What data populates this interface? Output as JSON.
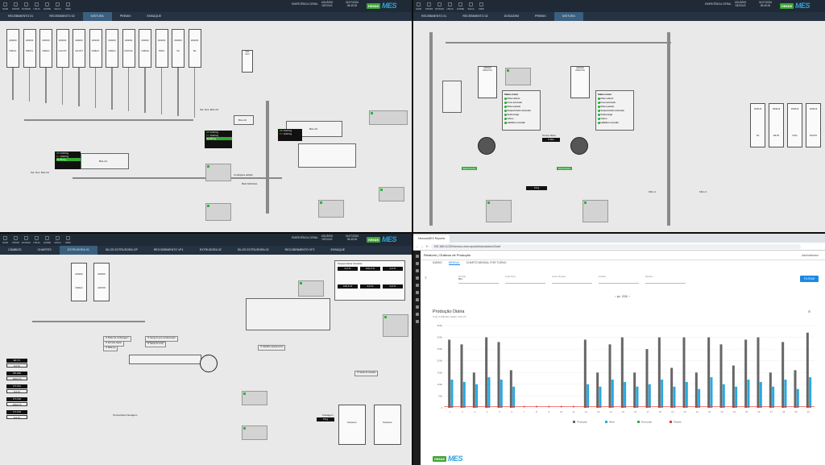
{
  "colors": {
    "scada_bg": "#e9e9e9",
    "topbar": "#1f2a36",
    "tabbar": "#243241",
    "active_tab": "#3a5f7f",
    "nexus_green": "#3fa535",
    "mes_blue": "#2ea3dc",
    "chart_blue": "#29a8e0",
    "chart_gray": "#666666",
    "chart_red": "#e53935"
  },
  "topbar": {
    "icons": [
      {
        "name": "exit-icon",
        "label": "SAIR"
      },
      {
        "name": "zoom-icon",
        "label": "ZOOM"
      },
      {
        "name": "bucket-icon",
        "label": "DOSAR"
      },
      {
        "name": "user-icon",
        "label": "USUA"
      },
      {
        "name": "home-icon",
        "label": "HOME"
      },
      {
        "name": "bag-icon",
        "label": "SACA"
      },
      {
        "name": "mes-icon",
        "label": "MES"
      }
    ],
    "emergency": "EMERGÊNCIA GERAL",
    "user_label": "USUÁRIO",
    "user": "NEXXUS",
    "date": "01/07/2026",
    "time": "08:45:26"
  },
  "brand": {
    "nexus": "nexus",
    "mes": "MES"
  },
  "q1": {
    "tabs": [
      "RECEBIMENTO 01",
      "RECEBIMENTO 02",
      "MISTURA",
      "PREMIX",
      "ENSAQUE"
    ],
    "active_tab": 2,
    "silos": [
      {
        "code": "2000030",
        "name": "FRETL1"
      },
      {
        "code": "2000030",
        "name": "FRETL2"
      },
      {
        "code": "2000030",
        "name": "FAREL2"
      },
      {
        "code": "2000030",
        "name": "CALCIT2"
      },
      {
        "code": "2000030",
        "name": "CALCIT3"
      },
      {
        "code": "2000030",
        "name": "FARELO"
      },
      {
        "code": "2000030",
        "name": "FAREL3"
      },
      {
        "code": "2000030",
        "name": "CASTCAL"
      },
      {
        "code": "2000030",
        "name": "CUBULE"
      },
      {
        "code": "2000030",
        "name": "TRIGO"
      },
      {
        "code": "2000030",
        "name": "SI1"
      },
      {
        "code": "2000030",
        "name": "SI2"
      }
    ],
    "silo_extra": {
      "code": "DS2",
      "name": "SIL3"
    },
    "bal01": "BAL-01",
    "bal02": "BAL-02",
    "bal03": "BAL-03",
    "sp_label": "SP",
    "pv_label": "PV",
    "sp": "0,00 Kg",
    "pv": "0,00 Kg",
    "tot": "47,80 Kg",
    "mix_value": "41,88 Kg",
    "sec_label": "Sel. Dos. BAL-01",
    "sec_label2": "Sel. Dos. BAL-03",
    "fail_note": "Condições adição",
    "bag_label": "BAG MANUAL"
  },
  "q2": {
    "tabs": [
      "RECEBIMENTO 01",
      "RECEBIMENTO 02",
      "DOSAGEM",
      "PREMIX",
      "MISTURA"
    ],
    "active_tab": 4,
    "tank1": {
      "code": "2000129",
      "name": "2000,8 KG"
    },
    "tank2": {
      "code": "2000129",
      "name": "2000,8 KG"
    },
    "legend": [
      "Motor aberto",
      "Freio acionado",
      "Motor parado",
      "Sequenciador acionado",
      "Sobrecarga",
      "Vácuo",
      "Habilitar rocessão"
    ],
    "legend_title": "Status motor",
    "press1": "Expressora",
    "press2": "Expressora",
    "rotary": "Rotativa",
    "temp_label": "Tempo Mixer",
    "temp": "0 Min",
    "filter": "Filtro 1",
    "filter2": "Filtro 2",
    "bottom_kg": "0 Kg",
    "silos": [
      {
        "code": "2000129",
        "name": "SI4"
      },
      {
        "code": "2000129",
        "name": "MILHO"
      },
      {
        "code": "2000129",
        "name": "SOJA"
      },
      {
        "code": "2000129",
        "name": "MILHO2"
      }
    ]
  },
  "q3": {
    "tabs": [
      "CÂMBIOS",
      "CHARTES",
      "EXTRUSORA 01",
      "SILOS EXTRUSORA 2/F",
      "RECOBRIMENTO VF1",
      "EXTRUSORA 02",
      "SILOS EXTRUSORA 02",
      "RECOBRIMENTO VF2",
      "ENSAQUE"
    ],
    "active_tab": 2,
    "silos": [
      {
        "code": "2000030",
        "name": "FAREL3"
      },
      {
        "code": "2000030",
        "name": "ASSTOR"
      }
    ],
    "checks": [
      "Modo de micdosagem",
      "Entrada digital",
      "Balança",
      "Setup do pré-condicionador",
      "Setup do corte",
      "Habilitar equipamento",
      "Setup do secador"
    ],
    "panel_title": "Sequenciador Secador",
    "readings": [
      "0,0 %",
      "100,0 %",
      "0,0 %",
      "100,0 %",
      "0,0 %",
      "0,0 %"
    ],
    "tags": [
      "EF-71",
      "SP-200",
      "CT-721",
      "CT-722",
      "CT-723"
    ],
    "dryer_title": "Temperatura Secagem",
    "kg": "0 Kg",
    "hoppers": [
      "Recipiente",
      "Recipiente"
    ],
    "carriage": "Caixagem"
  },
  "q4": {
    "browser_tab": "NexxusMES Reports",
    "url": "192.168.14.220/nexxus-mes-reports/#/productionChart",
    "bookmark": "Mais negócio",
    "page_title": "Relatório | Gráficos de Produção",
    "admin": "Administrador",
    "subtabs": [
      "DIÁRIO",
      "MENSAL",
      "CHARTS MENSAL POR TURNO"
    ],
    "active_subtab": 1,
    "filters": [
      "Período",
      "Linha Prod.",
      "Grupo Produto",
      "Produto",
      "Receita"
    ],
    "period_value": "Mês",
    "filter_button": "FILTRAR",
    "month": "jun. 2026"
  },
  "chart_data": {
    "type": "bar",
    "title": "Produção Diária",
    "subtitle": "Total: 6.098.000 | Média: 203.270",
    "categories": [
      "1",
      "2",
      "3",
      "4",
      "5",
      "6",
      "7",
      "8",
      "9",
      "10",
      "11",
      "12",
      "13",
      "14",
      "15",
      "16",
      "17",
      "18",
      "19",
      "20",
      "21",
      "22",
      "23",
      "24",
      "25",
      "26",
      "27",
      "28",
      "29",
      "30"
    ],
    "ylim": [
      0,
      350000
    ],
    "yticks": [
      "0",
      "50k",
      "100k",
      "150k",
      "200k",
      "250k",
      "300k",
      "350k"
    ],
    "series": [
      {
        "name": "Produção",
        "color": "#666666",
        "values": [
          290000,
          270000,
          150000,
          300000,
          280000,
          160000,
          0,
          0,
          0,
          0,
          0,
          290000,
          150000,
          270000,
          300000,
          150000,
          250000,
          300000,
          170000,
          300000,
          150000,
          300000,
          270000,
          180000,
          290000,
          300000,
          150000,
          280000,
          160000,
          320000
        ]
      },
      {
        "name": "Meta",
        "color": "#29a8e0",
        "values": [
          120000,
          110000,
          100000,
          130000,
          120000,
          90000,
          0,
          0,
          0,
          0,
          0,
          100000,
          90000,
          120000,
          110000,
          90000,
          100000,
          120000,
          90000,
          110000,
          80000,
          130000,
          100000,
          90000,
          120000,
          110000,
          90000,
          120000,
          80000,
          130000
        ]
      },
      {
        "name": "Execução",
        "color": "#2ab53a",
        "values": [
          0,
          0,
          0,
          0,
          0,
          0,
          0,
          0,
          0,
          0,
          0,
          0,
          0,
          0,
          0,
          0,
          0,
          0,
          0,
          0,
          0,
          0,
          0,
          0,
          0,
          0,
          0,
          0,
          0,
          0
        ]
      },
      {
        "name": "Parada",
        "color": "#e53935",
        "values": [
          5000,
          5000,
          5000,
          5000,
          5000,
          5000,
          5000,
          5000,
          5000,
          5000,
          5000,
          5000,
          5000,
          5000,
          5000,
          5000,
          5000,
          5000,
          5000,
          5000,
          5000,
          5000,
          5000,
          5000,
          5000,
          5000,
          5000,
          5000,
          5000,
          5000
        ]
      }
    ],
    "legend_position": "bottom"
  }
}
